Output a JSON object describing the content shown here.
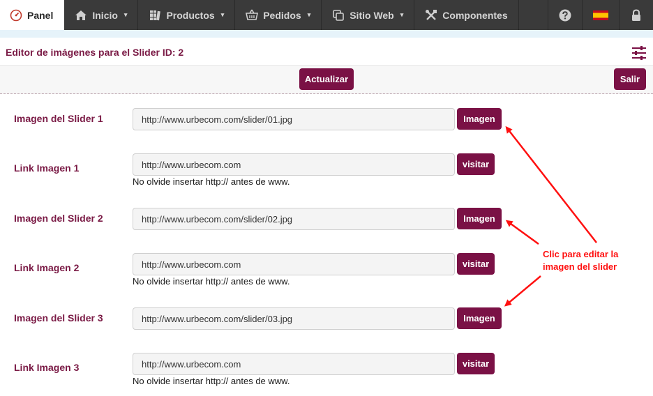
{
  "nav": {
    "panel": "Panel",
    "inicio": "Inicio",
    "productos": "Productos",
    "pedidos": "Pedidos",
    "sitio_web": "Sitio Web",
    "componentes": "Componentes",
    "caret": "▾",
    "icons": [
      "gauge-icon",
      "home-icon",
      "books-icon",
      "basket-icon",
      "copy-icon",
      "tools-icon",
      "help-icon",
      "spain-flag-icon",
      "lock-icon"
    ]
  },
  "header": {
    "title": "Editor de imágenes para el Slider ID: 2"
  },
  "toolbar": {
    "update_label": "Actualizar",
    "exit_label": "Salir"
  },
  "form": {
    "slider1_label": "Imagen del Slider 1",
    "slider1_value": "http://www.urbecom.com/slider/01.jpg",
    "link1_label": "Link Imagen 1",
    "link1_value": "http://www.urbecom.com",
    "slider2_label": "Imagen del Slider 2",
    "slider2_value": "http://www.urbecom.com/slider/02.jpg",
    "link2_label": "Link Imagen 2",
    "link2_value": "http://www.urbecom.com",
    "slider3_label": "Imagen del Slider 3",
    "slider3_value": "http://www.urbecom.com/slider/03.jpg",
    "link3_label": "Link Imagen 3",
    "link3_value": "http://www.urbecom.com",
    "image_button": "Imagen",
    "visit_button": "visitar",
    "hint": "No olvide insertar http:// antes de www."
  },
  "annotation": {
    "line1": "Clic para editar la",
    "line2": "imagen del slider"
  },
  "colors": {
    "brand": "#7a1145",
    "nav_bg": "#3a3a3a",
    "annotation": "#ff1010"
  }
}
